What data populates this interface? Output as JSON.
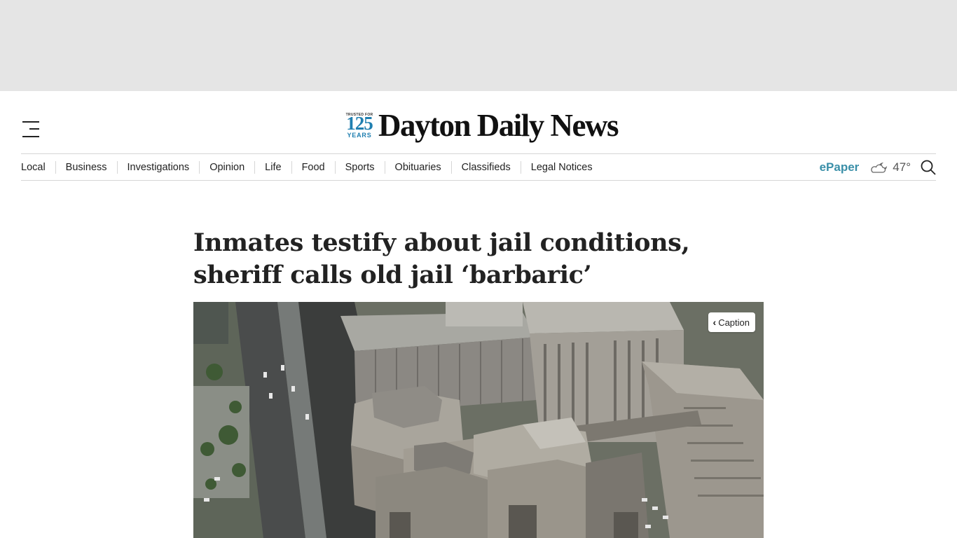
{
  "masthead": {
    "badge_top": "TRUSTED FOR",
    "badge_number": "125",
    "badge_years": "YEARS",
    "title": "Dayton Daily News"
  },
  "nav": {
    "items": [
      "Local",
      "Business",
      "Investigations",
      "Opinion",
      "Life",
      "Food",
      "Sports",
      "Obituaries",
      "Classifieds",
      "Legal Notices"
    ],
    "epaper": "ePaper",
    "temperature": "47°"
  },
  "article": {
    "headline_line1": "Inmates testify about jail conditions,",
    "headline_line2": "sheriff calls old jail ‘barbaric’",
    "caption_label": "Caption"
  },
  "icons": {
    "menu": "hamburger-menu-icon",
    "weather": "partly-cloudy-night-icon",
    "search": "search-icon",
    "caption": "chevron-left-icon"
  },
  "colors": {
    "accent": "#3a8fa8",
    "badge": "#1f7fb0",
    "ad_background": "#e5e5e5"
  }
}
